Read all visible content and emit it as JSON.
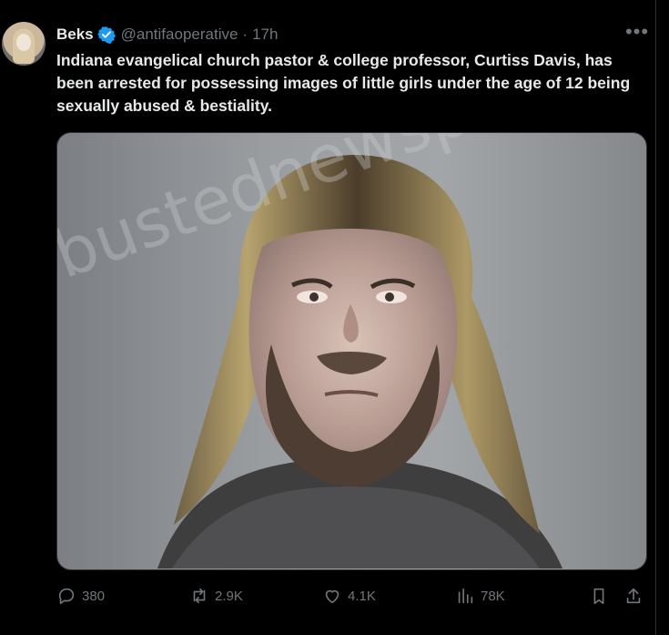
{
  "tweet": {
    "display_name": "Beks",
    "handle": "@antifaoperative",
    "separator": "·",
    "time": "17h",
    "text": "Indiana evangelical church pastor & college professor, Curtiss Davis, has been arrested for possessing images of little girls under the age of 12 being sexually abused & bestiality.",
    "image": {
      "watermark": "bustednewspaper.com"
    }
  },
  "actions": {
    "replies": "380",
    "reposts": "2.9K",
    "likes": "4.1K",
    "views": "78K"
  },
  "icons": [
    "verified-icon",
    "more-icon",
    "reply-icon",
    "repost-icon",
    "like-icon",
    "views-icon",
    "bookmark-icon",
    "share-icon"
  ],
  "colors": {
    "background": "#000000",
    "text": "#e7e9ea",
    "muted": "#71767b",
    "verified": "#1d9bf0"
  }
}
